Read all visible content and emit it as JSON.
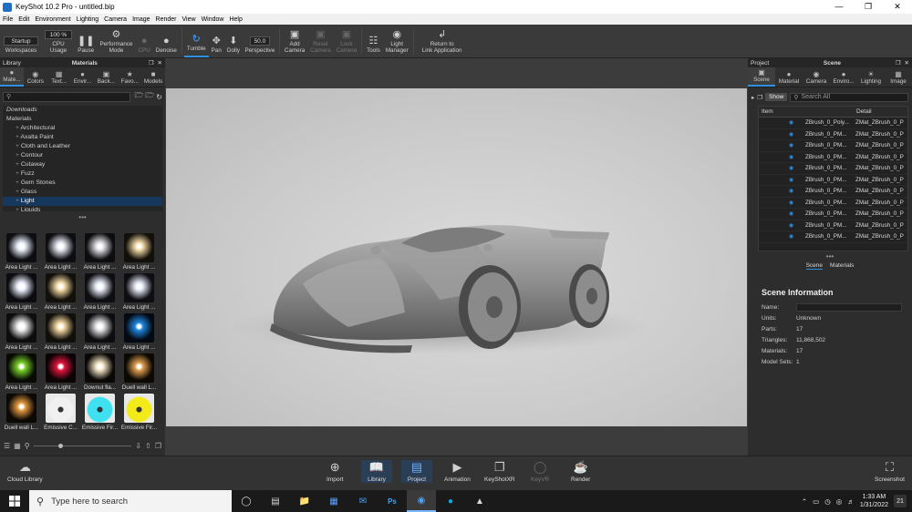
{
  "window": {
    "title": "KeyShot 10.2 Pro  -  untitled.bip"
  },
  "menu": [
    "File",
    "Edit",
    "Environment",
    "Lighting",
    "Camera",
    "Image",
    "Render",
    "View",
    "Window",
    "Help"
  ],
  "ribbon": {
    "workspace_value": "Startup",
    "workspaces_label": "Workspaces",
    "cpu_value": "100 %",
    "cpu_label": "CPU Usage",
    "pause_label": "Pause",
    "perf_label": "Performance\nMode",
    "cpu_btn_label": "CPU",
    "denoise_label": "Denoise",
    "tumble_label": "Tumble",
    "pan_label": "Pan",
    "dolly_label": "Dolly",
    "perspective_value": "50.0",
    "perspective_label": "Perspective",
    "add_camera_label": "Add\nCamera",
    "reset_camera_label": "Reset\nCamera",
    "lock_camera_label": "Lock\nCamera",
    "tools_label": "Tools",
    "light_manager_label": "Light\nManager",
    "return_label": "Return to\nLink Application"
  },
  "library": {
    "panel_label": "Library",
    "title": "Materials",
    "tabs": [
      {
        "label": "Mate...",
        "icon": "materials-icon"
      },
      {
        "label": "Colors",
        "icon": "colors-icon"
      },
      {
        "label": "Text...",
        "icon": "textures-icon"
      },
      {
        "label": "Envir...",
        "icon": "environments-icon"
      },
      {
        "label": "Back...",
        "icon": "backplates-icon"
      },
      {
        "label": "Favo...",
        "icon": "favorites-icon"
      },
      {
        "label": "Models",
        "icon": "models-icon"
      }
    ],
    "tree": [
      {
        "label": "Downloads",
        "indent": 0,
        "italic": true,
        "selected": false
      },
      {
        "label": "Materials",
        "indent": 0,
        "italic": false,
        "selected": false
      },
      {
        "label": "Architectural",
        "indent": 1,
        "italic": false,
        "selected": false
      },
      {
        "label": "Axalta Paint",
        "indent": 1,
        "italic": false,
        "selected": false
      },
      {
        "label": "Cloth and Leather",
        "indent": 1,
        "italic": false,
        "selected": false
      },
      {
        "label": "Contour",
        "indent": 1,
        "italic": false,
        "selected": false
      },
      {
        "label": "Cutaway",
        "indent": 1,
        "italic": false,
        "selected": false
      },
      {
        "label": "Fuzz",
        "indent": 1,
        "italic": false,
        "selected": false
      },
      {
        "label": "Gem Stones",
        "indent": 1,
        "italic": false,
        "selected": false
      },
      {
        "label": "Glass",
        "indent": 1,
        "italic": false,
        "selected": false
      },
      {
        "label": "Light",
        "indent": 1,
        "italic": false,
        "selected": true
      },
      {
        "label": "Liquids",
        "indent": 1,
        "italic": false,
        "selected": false
      }
    ],
    "thumbnails": [
      {
        "label": "Area Light ...",
        "glow": "#e8eef8",
        "bg": "#0d0d12"
      },
      {
        "label": "Area Light ...",
        "glow": "#e6e9f0",
        "bg": "#0d0d12"
      },
      {
        "label": "Area Light ...",
        "glow": "#e0e0e4",
        "bg": "#0d0d10"
      },
      {
        "label": "Area Light ...",
        "glow": "#f3d9a6",
        "bg": "#12100a"
      },
      {
        "label": "Area Light ...",
        "glow": "#eef2ff",
        "bg": "#0c0c10"
      },
      {
        "label": "Area Light ...",
        "glow": "#f6dca8",
        "bg": "#12100a"
      },
      {
        "label": "Area Light ...",
        "glow": "#e8ecf6",
        "bg": "#0d0d12"
      },
      {
        "label": "Area Light ...",
        "glow": "#e4e8f4",
        "bg": "#0d0d12"
      },
      {
        "label": "Area Light ...",
        "glow": "#f0f0f0",
        "bg": "#0d0d0d"
      },
      {
        "label": "Area Light ...",
        "glow": "#f3d7a2",
        "bg": "#110f0a"
      },
      {
        "label": "Area Light ...",
        "glow": "#e6e6ea",
        "bg": "#0d0d0f"
      },
      {
        "label": "Area Light ...",
        "glow": "#1f86e0",
        "bg": "#050a12"
      },
      {
        "label": "Area Light ...",
        "glow": "#7bd22a",
        "bg": "#070b04"
      },
      {
        "label": "Area Light ...",
        "glow": "#e0143c",
        "bg": "#0c0305"
      },
      {
        "label": "Downut fla...",
        "glow": "#f2e4c4",
        "bg": "#0a0806"
      },
      {
        "label": "Duell wall L...",
        "glow": "#e0a050",
        "bg": "#0c0804"
      },
      {
        "label": "Duell wall L...",
        "glow": "#e59a40",
        "bg": "#0c0804"
      },
      {
        "label": "Emissive C...",
        "glow": "#f0f0f0",
        "bg": "#e8e8e8"
      },
      {
        "label": "Emissive Fir...",
        "glow": "#3fe0f0",
        "bg": "#e8e8e8"
      },
      {
        "label": "Emissive Fir...",
        "glow": "#f3ea1a",
        "bg": "#e8e8e8"
      }
    ]
  },
  "scene": {
    "panel_label": "Project",
    "title": "Scene",
    "tabs": [
      {
        "label": "Scene",
        "icon": "scene-icon"
      },
      {
        "label": "Material",
        "icon": "material-icon"
      },
      {
        "label": "Camera",
        "icon": "camera-icon"
      },
      {
        "label": "Enviro...",
        "icon": "environment-icon"
      },
      {
        "label": "Lighting",
        "icon": "lighting-icon"
      },
      {
        "label": "Image",
        "icon": "image-icon"
      }
    ],
    "show_label": "Show",
    "search_placeholder": "Search All",
    "col_item": "Item",
    "col_detail": "Detail",
    "rows": [
      {
        "item": "ZBrush_0_Poly...",
        "detail": "ZMat_ZBrush_0_P"
      },
      {
        "item": "ZBrush_0_PM...",
        "detail": "ZMat_ZBrush_0_P"
      },
      {
        "item": "ZBrush_0_PM...",
        "detail": "ZMat_ZBrush_0_P"
      },
      {
        "item": "ZBrush_0_PM...",
        "detail": "ZMat_ZBrush_0_P"
      },
      {
        "item": "ZBrush_0_PM...",
        "detail": "ZMat_ZBrush_0_P"
      },
      {
        "item": "ZBrush_0_PM...",
        "detail": "ZMat_ZBrush_0_P"
      },
      {
        "item": "ZBrush_0_PM...",
        "detail": "ZMat_ZBrush_0_P"
      },
      {
        "item": "ZBrush_0_PM...",
        "detail": "ZMat_ZBrush_0_P"
      },
      {
        "item": "ZBrush_0_PM...",
        "detail": "ZMat_ZBrush_0_P"
      },
      {
        "item": "ZBrush_0_PM...",
        "detail": "ZMat_ZBrush_0_P"
      },
      {
        "item": "ZBrush_0_PM...",
        "detail": "ZMat_ZBrush_0_P"
      }
    ],
    "subtab_scene": "Scene",
    "subtab_materials": "Materials",
    "info": {
      "heading": "Scene Information",
      "name_label": "Name:",
      "units_label": "Units:",
      "units_value": "Unknown",
      "parts_label": "Parts:",
      "parts_value": "17",
      "triangles_label": "Triangles:",
      "triangles_value": "11,868,502",
      "materials_label": "Materials:",
      "materials_value": "17",
      "modelsets_label": "Model Sets:",
      "modelsets_value": "1"
    }
  },
  "bottom": {
    "cloud_library": "Cloud Library",
    "import": "Import",
    "library": "Library",
    "project": "Project",
    "animation": "Animation",
    "keyshotxr": "KeyShotXR",
    "keyvr": "KeyVR",
    "render": "Render",
    "screenshot": "Screenshot"
  },
  "taskbar": {
    "search_placeholder": "Type here to search",
    "time": "1:33 AM",
    "date": "1/31/2022",
    "notifications": "21"
  }
}
